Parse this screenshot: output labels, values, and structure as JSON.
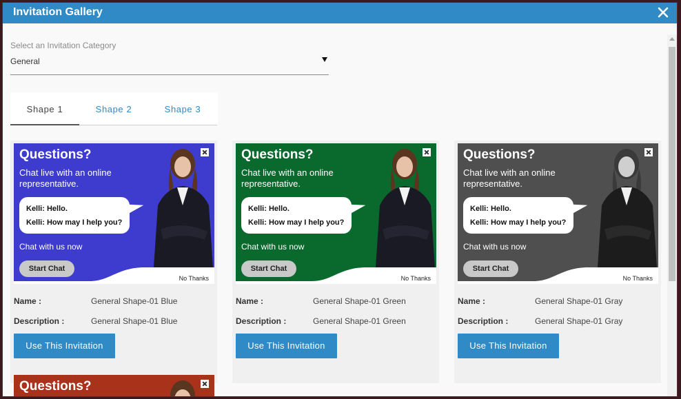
{
  "dialog": {
    "title": "Invitation Gallery"
  },
  "category": {
    "label": "Select an Invitation Category",
    "value": "General"
  },
  "tabs": [
    {
      "label": "Shape 1",
      "active": true
    },
    {
      "label": "Shape 2",
      "active": false
    },
    {
      "label": "Shape 3",
      "active": false
    }
  ],
  "labels": {
    "name": "Name :",
    "description": "Description :",
    "use_button": "Use This Invitation"
  },
  "preview": {
    "title": "Questions?",
    "subtitle": "Chat live with an online representative.",
    "line1": "Kelli: Hello.",
    "line2": "Kelli: How may I help you?",
    "chat_now": "Chat with us now",
    "start_chat": "Start Chat",
    "no_thanks": "No Thanks"
  },
  "cards": [
    {
      "name": "General Shape-01 Blue",
      "description": "General Shape-01 Blue",
      "color": "#3d3ccf"
    },
    {
      "name": "General Shape-01 Green",
      "description": "General Shape-01 Green",
      "color": "#0a6a2e"
    },
    {
      "name": "General Shape-01 Gray",
      "description": "General Shape-01 Gray",
      "color": "#4f4f4f"
    }
  ],
  "partial_card": {
    "title": "Questions?",
    "color": "#a8321a"
  }
}
